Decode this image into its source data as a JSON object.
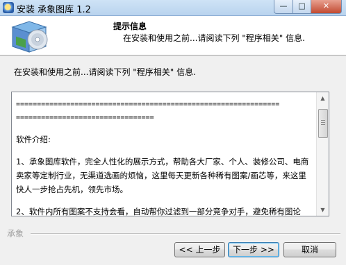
{
  "window": {
    "title": "安装 承象图库 1.2",
    "minimize_label": "—",
    "maximize_label": "□",
    "close_label": "✕"
  },
  "header": {
    "title": "提示信息",
    "subtitle": "在安装和使用之前...请阅读下列 \"程序相关\" 信息."
  },
  "intro_text": "在安装和使用之前...请阅读下列 \"程序相关\" 信息.",
  "license": {
    "separator_line1": "===============================================================",
    "separator_line2": "=================================",
    "section_heading": "软件介绍:",
    "para1": "1、承象图库软件，完全人性化的展示方式，帮助各大厂家、个人、装修公司、电商卖家等定制行业，无渠道选画的烦恼，这里每天更新各种稀有图案/画芯等，来这里快人一步抢占先机，领先市场。",
    "para2": "2、软件内所有图案不支持会看，自动帮你过滤到一部分竞争对手，避免稀有图论"
  },
  "footer": {
    "brand": "承象",
    "back_label": "<< 上一步",
    "next_label": "下一步 >>",
    "cancel_label": "取消"
  },
  "icons": {
    "app": "installer-cd-icon",
    "header": "cd-box-icon"
  }
}
